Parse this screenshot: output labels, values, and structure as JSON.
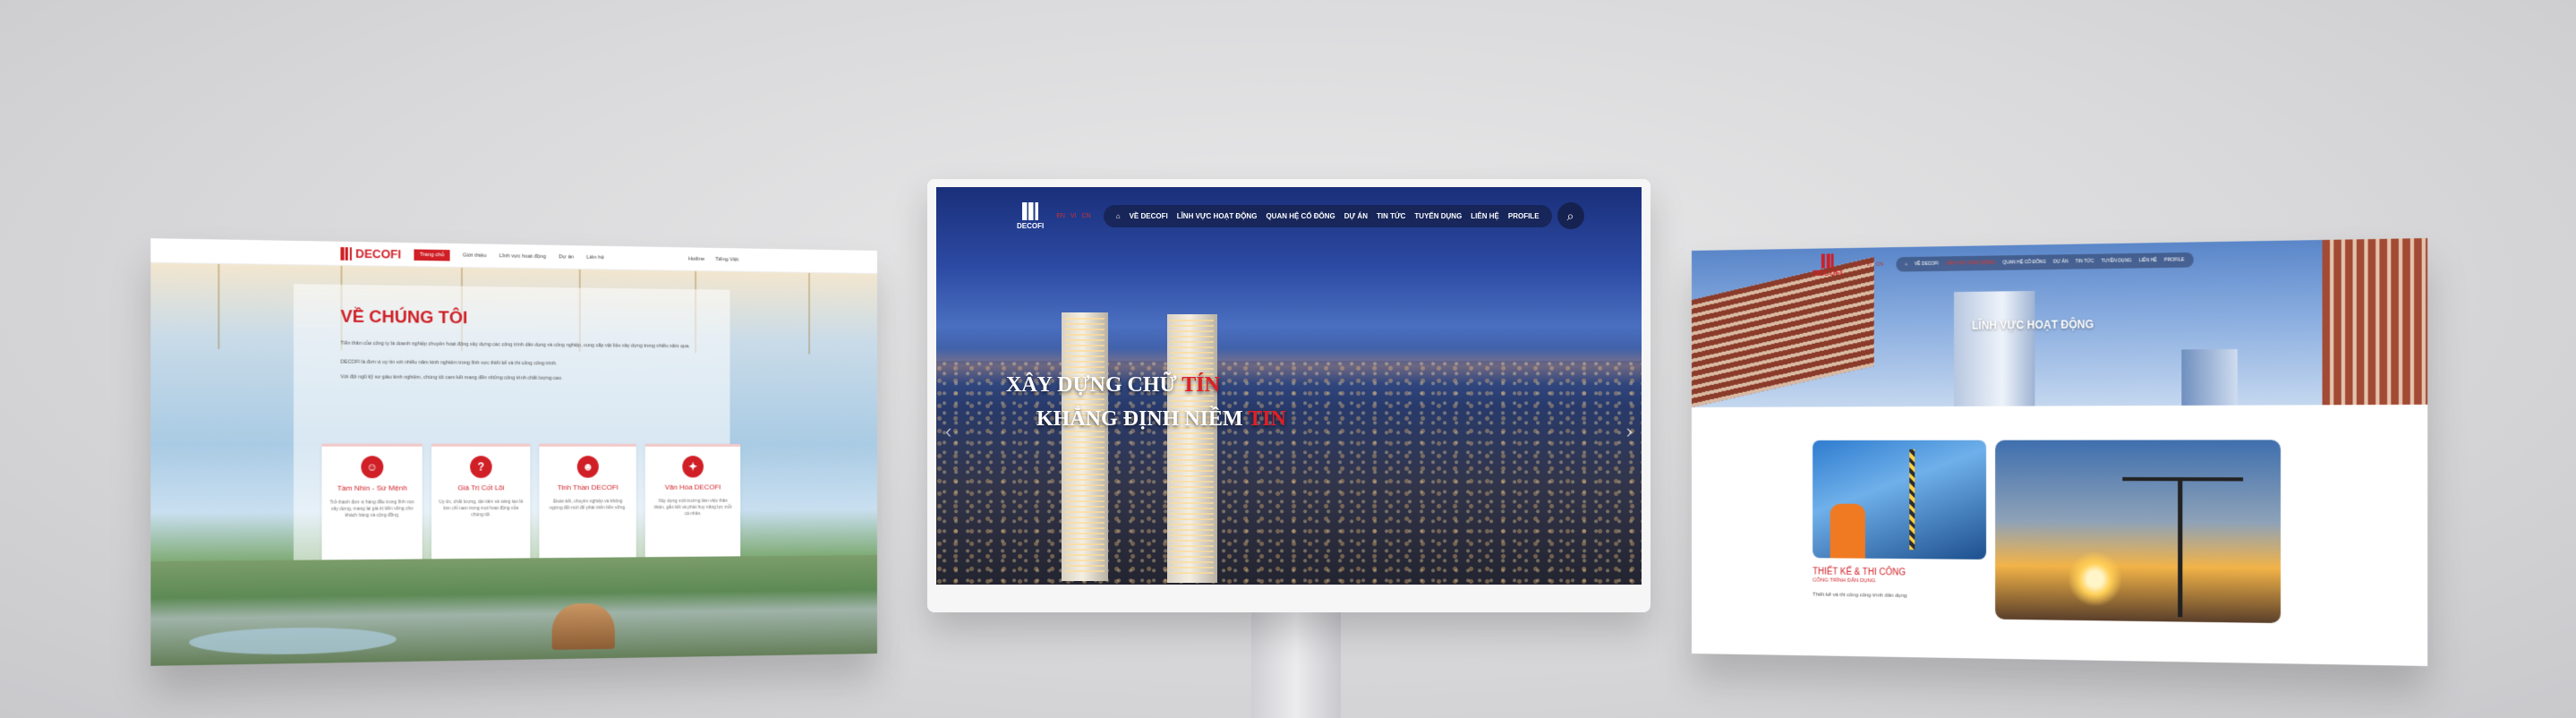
{
  "left_screen": {
    "logo": "DECOFI",
    "nav": [
      "Trang chủ",
      "Giới thiệu",
      "Lĩnh vực hoạt động",
      "Dự án",
      "Liên hệ"
    ],
    "nav_right": [
      "Hotline",
      "Tiếng Việt"
    ],
    "title": "VỀ CHÚNG TÔI",
    "paragraphs": [
      "Tiền thân của công ty là doanh nghiệp chuyên hoạt động xây dựng các công trình dân dụng và công nghiệp, cung cấp vật liệu xây dựng trong nhiều năm qua.",
      "DECOFI là đơn vị uy tín với nhiều năm kinh nghiệm trong lĩnh vực thiết kế và thi công công trình.",
      "Với đội ngũ kỹ sư giàu kinh nghiệm, chúng tôi cam kết mang đến những công trình chất lượng cao."
    ],
    "features": [
      {
        "title": "Tầm Nhìn - Sứ Mệnh",
        "icon": "person-icon",
        "text": "Trở thành đơn vị hàng đầu trong lĩnh vực xây dựng, mang lại giá trị bền vững cho khách hàng và cộng đồng."
      },
      {
        "title": "Giá Trị Cốt Lõi",
        "icon": "question-icon",
        "text": "Uy tín, chất lượng, tận tâm và sáng tạo là kim chỉ nam trong mọi hoạt động của chúng tôi."
      },
      {
        "title": "Tinh Thần DECOFI",
        "icon": "people-icon",
        "text": "Đoàn kết, chuyên nghiệp và không ngừng đổi mới để phát triển bền vững."
      },
      {
        "title": "Văn Hóa DECOFI",
        "icon": "lightbulb-icon",
        "text": "Xây dựng môi trường làm việc thân thiện, gắn kết và phát huy năng lực mỗi cá nhân."
      }
    ]
  },
  "center_screen": {
    "logo": "DECOFI",
    "lang": [
      "EN",
      "VI",
      "CN"
    ],
    "menu": [
      "VỀ DECOFI",
      "LĨNH VỰC HOẠT ĐỘNG",
      "QUAN HỆ CỔ ĐÔNG",
      "DỰ ÁN",
      "TIN TỨC",
      "TUYỂN DỤNG",
      "LIÊN HỆ",
      "PROFILE"
    ],
    "slogan_line1": "XÂY DỰNG CHỮ",
    "slogan_line1_accent": "TÍN",
    "slogan_line2": "KHẲNG ĐỊNH NIỀM",
    "slogan_line2_accent": "TIN",
    "accent_color": "#e21e26"
  },
  "right_screen": {
    "logo": "DECOFI",
    "lang": [
      "EN",
      "VI",
      "CN"
    ],
    "menu": [
      "VỀ DECOFI",
      "LĨNH VỰC HOẠT ĐỘNG",
      "QUAN HỆ CỔ ĐÔNG",
      "DỰ ÁN",
      "TIN TỨC",
      "TUYỂN DỤNG",
      "LIÊN HỆ",
      "PROFILE"
    ],
    "hero_title": "LĨNH VỰC HOẠT ĐỘNG",
    "card_title": "THIẾT KẾ & THI CÔNG",
    "card_subtitle": "CÔNG TRÌNH DÂN DỤNG",
    "card_text": "Thiết kế và thi công công trình dân dụng"
  }
}
